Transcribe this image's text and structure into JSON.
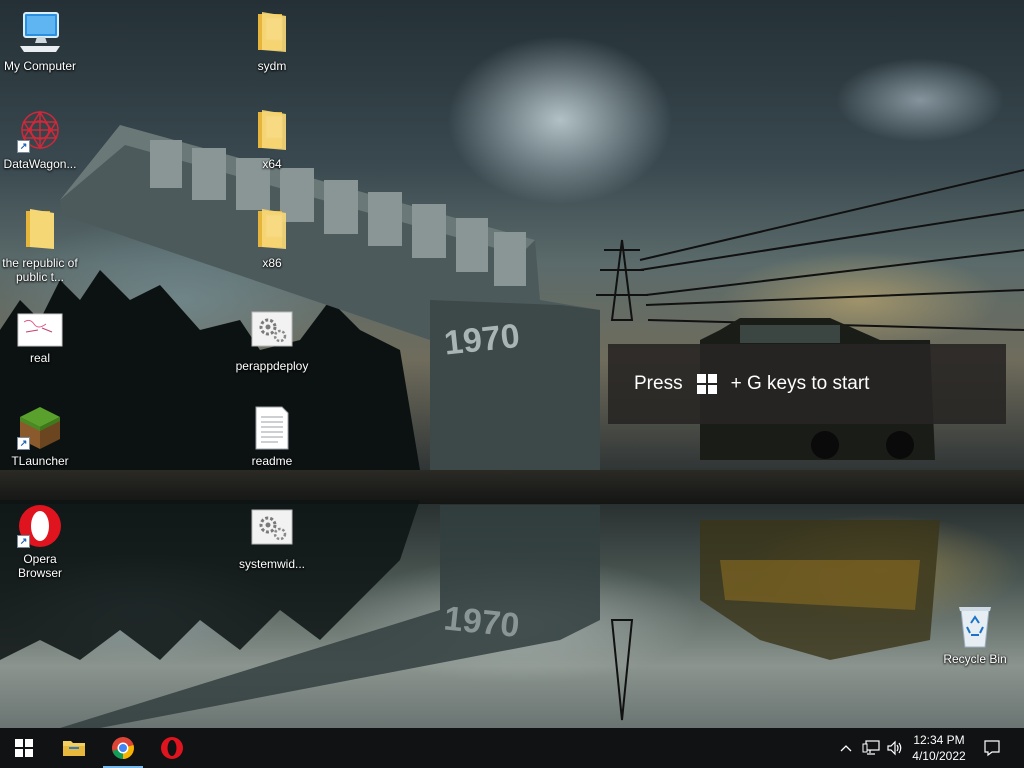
{
  "desktop": {
    "icons": [
      {
        "label": "My Computer",
        "icon": "computer-icon"
      },
      {
        "label": "DataWagon...",
        "icon": "datawagon-app-icon"
      },
      {
        "label": "the republic of public t...",
        "icon": "folder-icon"
      },
      {
        "label": "real",
        "icon": "image-file-icon"
      },
      {
        "label": "TLauncher",
        "icon": "tlauncher-icon"
      },
      {
        "label": "Opera Browser",
        "icon": "opera-icon"
      },
      {
        "label": "sydm",
        "icon": "folder-icon"
      },
      {
        "label": "x64",
        "icon": "folder-icon"
      },
      {
        "label": "x86",
        "icon": "folder-icon"
      },
      {
        "label": "perappdeploy",
        "icon": "settings-file-icon"
      },
      {
        "label": "readme",
        "icon": "text-file-icon"
      },
      {
        "label": "systemwid...",
        "icon": "settings-file-icon"
      },
      {
        "label": "Recycle Bin",
        "icon": "recycle-bin-icon"
      }
    ]
  },
  "wallpaper": {
    "sign_year": "1970",
    "reflection_text": "1970"
  },
  "toast": {
    "prefix": "Press",
    "suffix": "+ G keys to start",
    "key_icon": "windows-logo-icon"
  },
  "taskbar": {
    "start_icon": "windows-start-icon",
    "pinned": [
      {
        "name": "file-explorer",
        "icon": "folder-icon"
      },
      {
        "name": "chrome",
        "icon": "chrome-icon"
      },
      {
        "name": "opera",
        "icon": "opera-icon"
      }
    ],
    "tray": {
      "chevron_icon": "chevron-up-icon",
      "network_icon": "network-icon",
      "volume_icon": "speaker-icon",
      "notifications_icon": "notification-icon"
    },
    "clock": {
      "time": "12:34 PM",
      "date": "4/10/2022"
    }
  },
  "colors": {
    "taskbar": "#101214",
    "toast_bg": "#282624",
    "opera_red": "#e0141e",
    "folder_yellow": "#f3cf60"
  }
}
